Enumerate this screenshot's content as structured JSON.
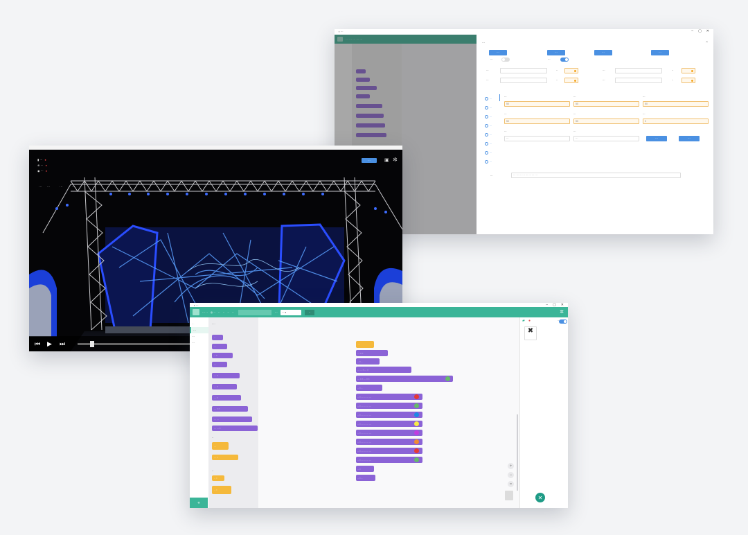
{
  "settings_window": {
    "action_buttons": [
      "···",
      "···",
      "···",
      "···"
    ],
    "toggle_a_on": false,
    "toggle_b_on": true,
    "radio_items": [
      "···",
      "···",
      "···",
      "···",
      "···",
      "···",
      "···",
      "···"
    ],
    "field_values": [
      "50",
      "50",
      "50",
      "50",
      "50",
      "0"
    ],
    "color_accent": "#4a90e2",
    "warning_color": "#f5a623"
  },
  "video_window": {
    "action_label": "···",
    "distances": [
      "···",
      "···",
      "···",
      "···"
    ],
    "progress_fraction": 0.04,
    "icons": [
      "camera-icon",
      "gear-icon",
      "prev-icon",
      "play-icon",
      "next-icon"
    ]
  },
  "block_editor": {
    "brand_color": "#3bb598",
    "categories": [
      "···",
      "···",
      "···"
    ],
    "code_rows": 17,
    "led_colors": [
      "#e53935",
      "#66bb6a",
      "#1e88e5",
      "#f7ea48",
      "#c03de0",
      "#ef8a35",
      "#e53935",
      "#66bb6a"
    ],
    "toggle_on": true
  }
}
